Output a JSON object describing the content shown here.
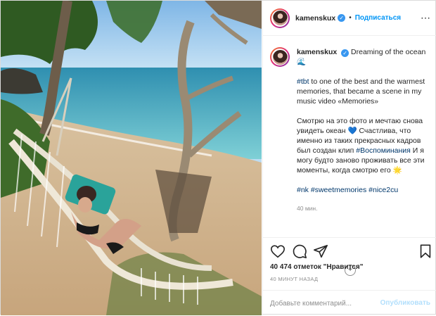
{
  "post": {
    "username": "kamenskux",
    "follow_label": "Подписаться",
    "more_icon": "more-horizontal-icon",
    "photo_alt": "",
    "caption": {
      "author": "kamenskux",
      "title": "Dreaming of the ocean",
      "title_emoji": "🌊",
      "p1_tag": "#tbt",
      "p1_text": " to one of the best and the warmest memories, that became a scene in my music video «Memories»",
      "p2_text": "Смотрю на это фото и мечтаю снова увидеть океан 💙 Счастлива, что именно из таких прекрасных кадров был создан клип ",
      "p2_tag": "#Воспоминания",
      "p2_text2": " И я могу будто заново проживать все эти моменты, когда смотрю его 🌟",
      "tags": [
        "#nk",
        "#sweetmemories",
        "#nice2cu"
      ]
    },
    "caption_time": "40 мин.",
    "likes_text": "40 474 отметок \"Нравится\"",
    "time_ago": "40 МИНУТ НАЗАД",
    "comment_placeholder": "Добавьте комментарий...",
    "publish_label": "Опубликовать",
    "colors": {
      "link": "#0095f6",
      "hashtag": "#00376b",
      "muted": "#8e8e8e",
      "publish_disabled": "#b2dffc"
    }
  }
}
